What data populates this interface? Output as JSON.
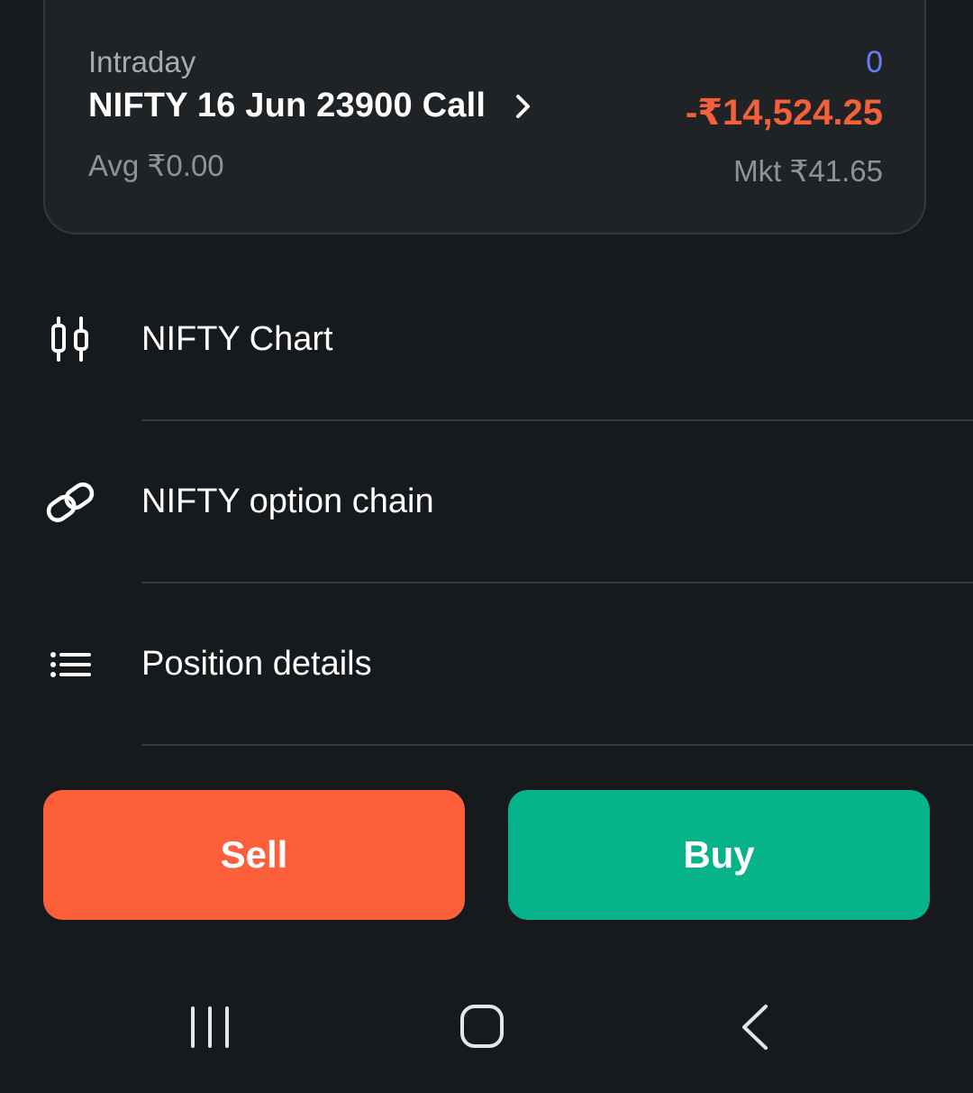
{
  "position_card": {
    "product": "Intraday",
    "title": "NIFTY 16 Jun 23900 Call",
    "avg": "Avg ₹0.00",
    "quantity": "0",
    "pnl": "-₹14,524.25",
    "market_price": "Mkt ₹41.65"
  },
  "menu": {
    "items": [
      {
        "label": "NIFTY Chart",
        "icon": "candlestick-chart-icon"
      },
      {
        "label": "NIFTY option chain",
        "icon": "link-chain-icon"
      },
      {
        "label": "Position details",
        "icon": "list-icon"
      }
    ]
  },
  "actions": {
    "sell_label": "Sell",
    "buy_label": "Buy"
  },
  "navbar": {
    "icons": [
      "recent-apps-icon",
      "home-icon",
      "back-icon"
    ]
  },
  "colors": {
    "background": "#161a1c",
    "card": "#202326",
    "loss": "#f4603a",
    "quantity": "#6c7cf5",
    "sell": "#fc5f3a",
    "buy": "#07b38a"
  }
}
